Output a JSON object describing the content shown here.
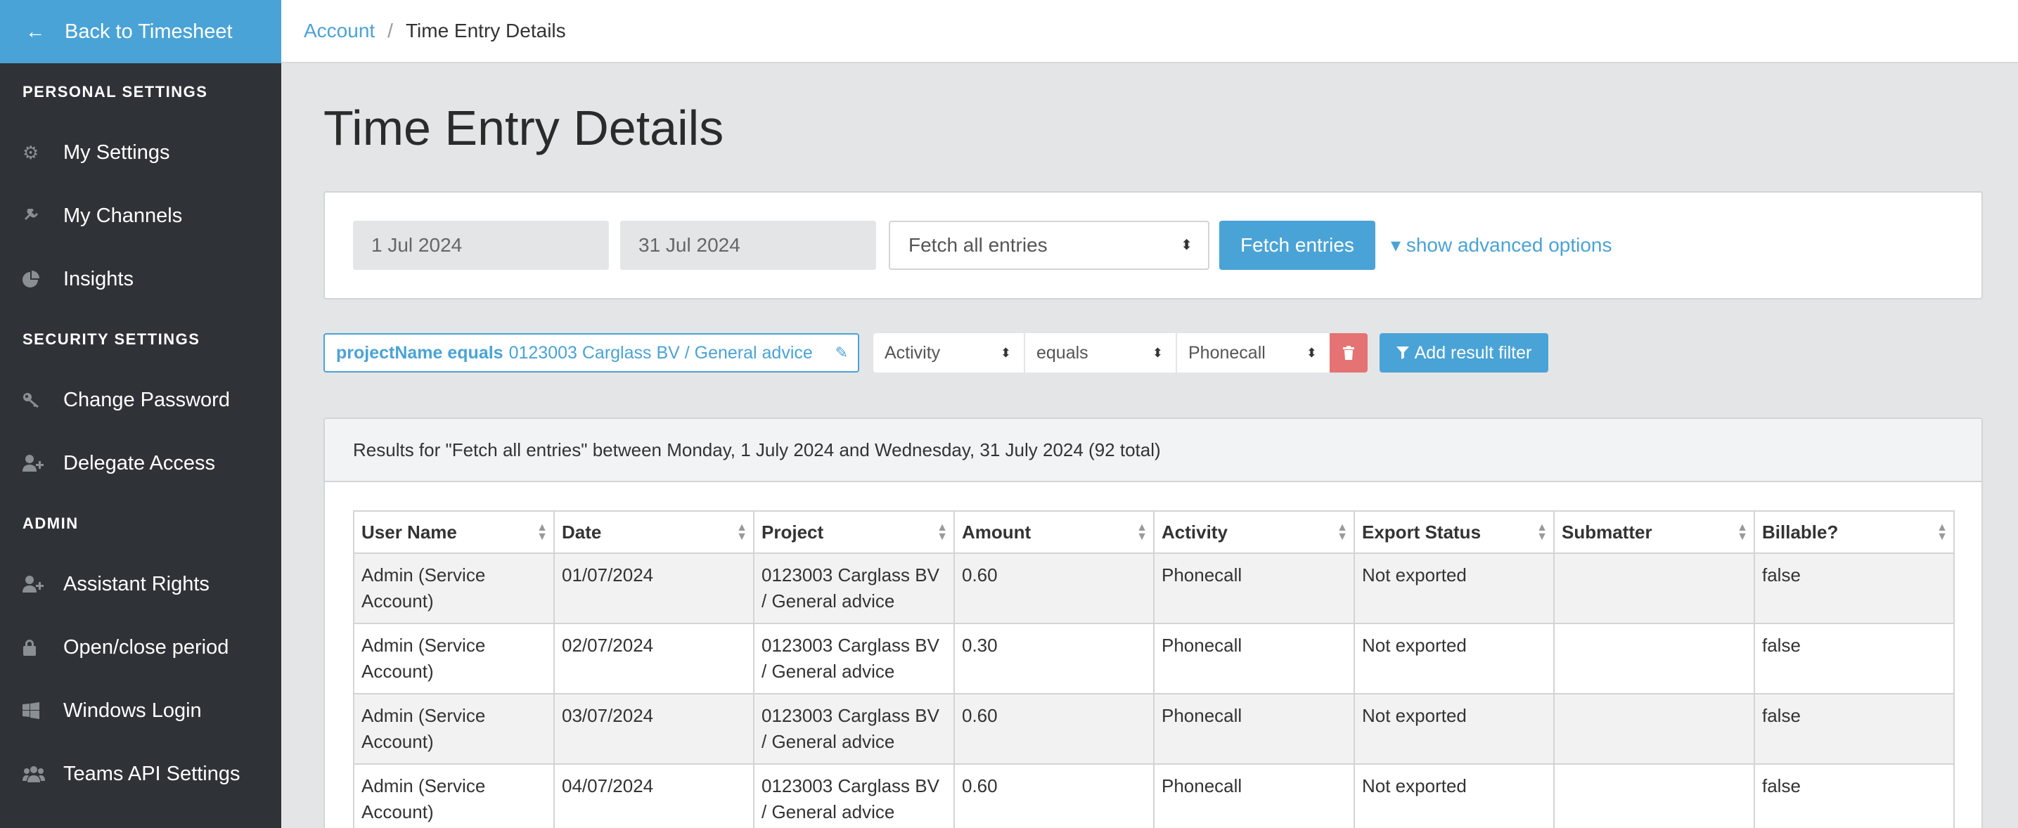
{
  "sidebar": {
    "back_label": "Back to Timesheet",
    "sections": [
      {
        "title": "PERSONAL SETTINGS",
        "items": [
          {
            "label": "My Settings",
            "icon": "gear-icon"
          },
          {
            "label": "My Channels",
            "icon": "plug-icon"
          },
          {
            "label": "Insights",
            "icon": "pie-chart-icon"
          }
        ]
      },
      {
        "title": "SECURITY SETTINGS",
        "items": [
          {
            "label": "Change Password",
            "icon": "key-icon"
          },
          {
            "label": "Delegate Access",
            "icon": "user-plus-icon"
          }
        ]
      },
      {
        "title": "ADMIN",
        "items": [
          {
            "label": "Assistant Rights",
            "icon": "user-plus-icon"
          },
          {
            "label": "Open/close period",
            "icon": "lock-icon"
          },
          {
            "label": "Windows Login",
            "icon": "windows-icon"
          },
          {
            "label": "Teams API Settings",
            "icon": "users-icon"
          }
        ]
      }
    ]
  },
  "breadcrumb": {
    "parent": "Account",
    "separator": "/",
    "current": "Time Entry Details"
  },
  "page_title": "Time Entry Details",
  "query": {
    "start_date": "1 Jul 2024",
    "end_date": "31 Jul 2024",
    "mode_selected": "Fetch all entries",
    "fetch_button": "Fetch entries",
    "advanced_link": "show advanced options"
  },
  "filter": {
    "chip_key": "projectName equals",
    "chip_value": "0123003 Carglass BV / General advice",
    "field_selected": "Activity",
    "operator_selected": "equals",
    "value_selected": "Phonecall",
    "add_button": "Add result filter"
  },
  "results": {
    "summary": "Results for \"Fetch all entries\" between Monday, 1 July 2024 and Wednesday, 31 July 2024 (92 total)",
    "columns": [
      "User Name",
      "Date",
      "Project",
      "Amount",
      "Activity",
      "Export Status",
      "Submatter",
      "Billable?"
    ],
    "rows": [
      [
        "Admin (Service Account)",
        "01/07/2024",
        "0123003 Carglass BV / General advice",
        "0.60",
        "Phonecall",
        "Not exported",
        "",
        "false"
      ],
      [
        "Admin (Service Account)",
        "02/07/2024",
        "0123003 Carglass BV / General advice",
        "0.30",
        "Phonecall",
        "Not exported",
        "",
        "false"
      ],
      [
        "Admin (Service Account)",
        "03/07/2024",
        "0123003 Carglass BV / General advice",
        "0.60",
        "Phonecall",
        "Not exported",
        "",
        "false"
      ],
      [
        "Admin (Service Account)",
        "04/07/2024",
        "0123003 Carglass BV / General advice",
        "0.60",
        "Phonecall",
        "Not exported",
        "",
        "false"
      ]
    ]
  },
  "colors": {
    "accent": "#4aa3d6",
    "sidebar_bg": "#2f3337",
    "danger": "#e57373"
  }
}
